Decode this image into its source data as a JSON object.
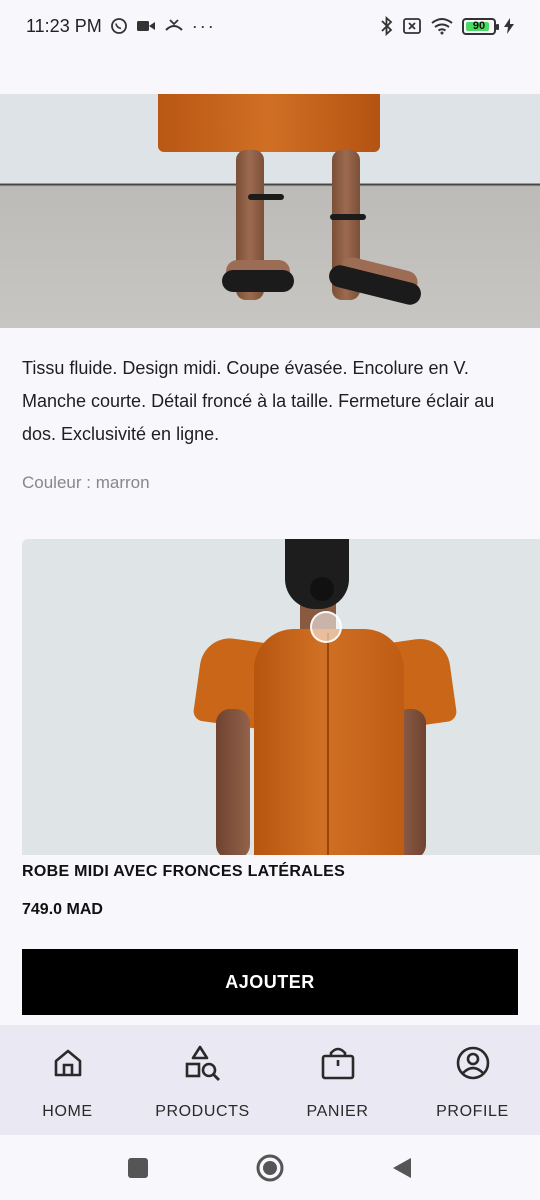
{
  "status_bar": {
    "time": "11:23 PM",
    "battery_level": "90",
    "battery_fraction": 0.9,
    "icons_left": [
      "whatsapp-icon",
      "video-icon",
      "missed-call-icon",
      "more-dots-icon"
    ],
    "icons_right": [
      "bluetooth-icon",
      "no-sim-icon",
      "wifi-icon",
      "battery-icon",
      "charging-icon"
    ],
    "dots": "···"
  },
  "product": {
    "description": "Tissu fluide. Design midi. Coupe évasée. Encolure en V. Manche courte. Détail froncé à la taille. Fermeture éclair au dos. Exclusivité en ligne.",
    "color_line": "Couleur : marron",
    "title": "ROBE MIDI AVEC FRONCES LATÉRALES",
    "price": "749.0 MAD",
    "add_button_label": "AJOUTER"
  },
  "bottom_nav": {
    "items": [
      {
        "label": "HOME",
        "icon": "home-icon"
      },
      {
        "label": "PRODUCTS",
        "icon": "shapes-search-icon"
      },
      {
        "label": "PANIER",
        "icon": "shopping-bag-icon"
      },
      {
        "label": "PROFILE",
        "icon": "account-circle-icon"
      }
    ]
  },
  "system_nav": {
    "buttons": [
      "recents-square-icon",
      "home-circle-icon",
      "back-triangle-icon"
    ]
  },
  "colors": {
    "background": "#f7f7fc",
    "nav_background": "#e9e8f3",
    "button_background": "#000000",
    "dress_orange": "#c96618"
  }
}
